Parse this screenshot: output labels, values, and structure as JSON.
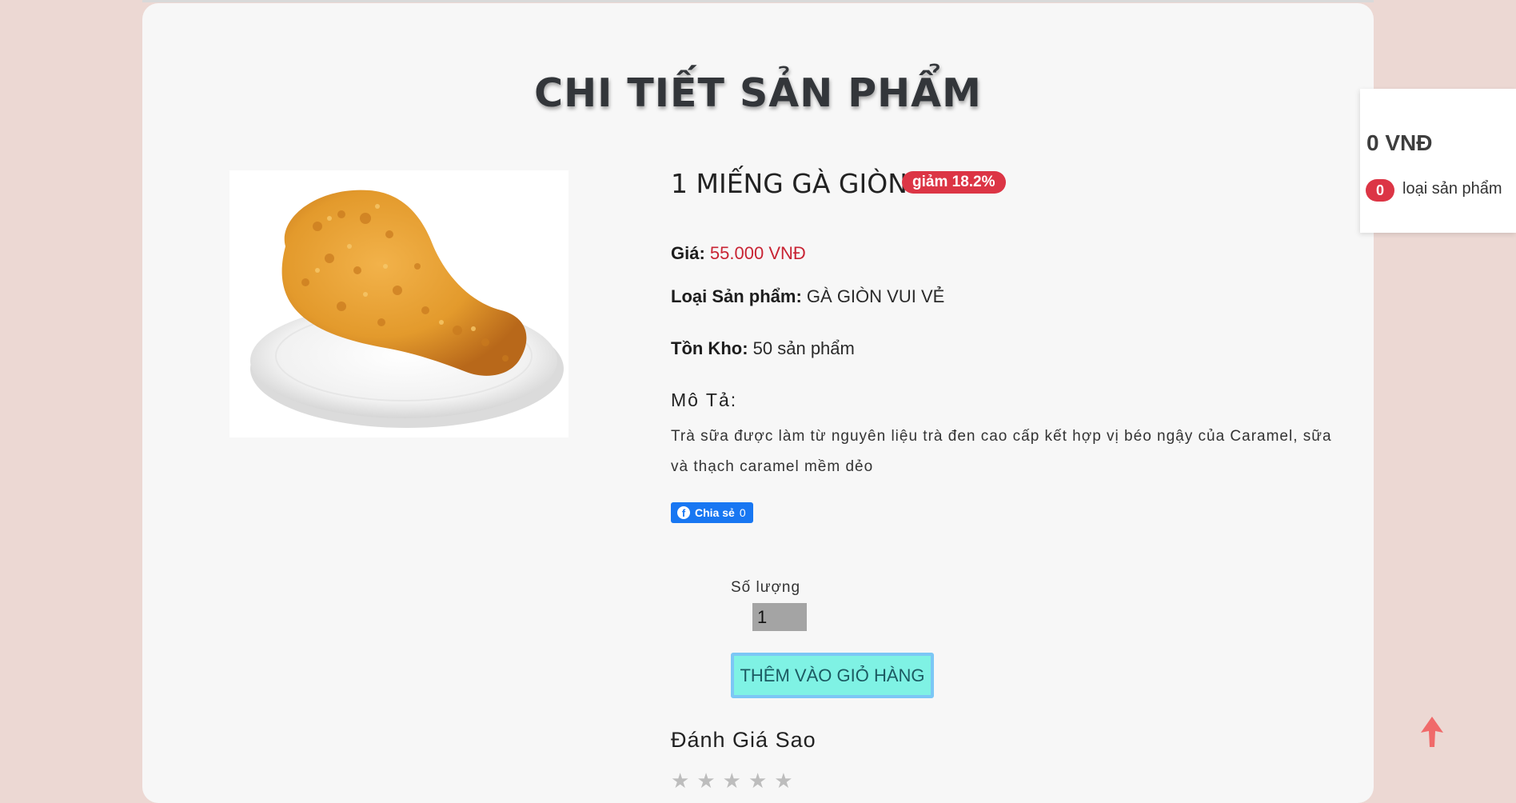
{
  "page": {
    "title": "CHI TIẾT SẢN PHẨM"
  },
  "product": {
    "name": "1 MIẾNG GÀ GIÒN",
    "discount_badge": "giảm 18.2%",
    "price_label": "Giá:",
    "price_value": "55.000 VNĐ",
    "category_label": "Loại Sản phẩm:",
    "category_value": "GÀ GIÒN VUI VẺ",
    "stock_label": "Tồn Kho:",
    "stock_value": "50 sản phẩm",
    "description_heading": "Mô Tả:",
    "description_text": "Trà sữa được làm từ nguyên liệu trà đen cao cấp kết hợp vị béo ngậy của Caramel, sữa và thạch caramel mềm dẻo",
    "image_icon": "fried-chicken-image"
  },
  "share": {
    "label": "Chia sẻ",
    "count": "0",
    "icon": "facebook-icon"
  },
  "quantity": {
    "label": "Số lượng",
    "value": "1"
  },
  "actions": {
    "add_to_cart": "THÊM VÀO GIỎ HÀNG"
  },
  "rating": {
    "heading": "Đánh Giá Sao",
    "stars_total": 5,
    "stars_filled": 0
  },
  "cart_widget": {
    "total": "0 VNĐ",
    "count": "0",
    "count_label": "loại sản phẩm"
  },
  "colors": {
    "background": "#ecd8d3",
    "badge": "#dc3545",
    "price": "#c82333",
    "add_to_cart_bg": "#7ff2e4",
    "add_to_cart_border": "#7cc7f5",
    "facebook": "#1877f2",
    "scroll_top_arrow": "#f06a6a"
  },
  "icons": {
    "scroll_top": "arrow-up-icon",
    "star": "star-icon"
  }
}
